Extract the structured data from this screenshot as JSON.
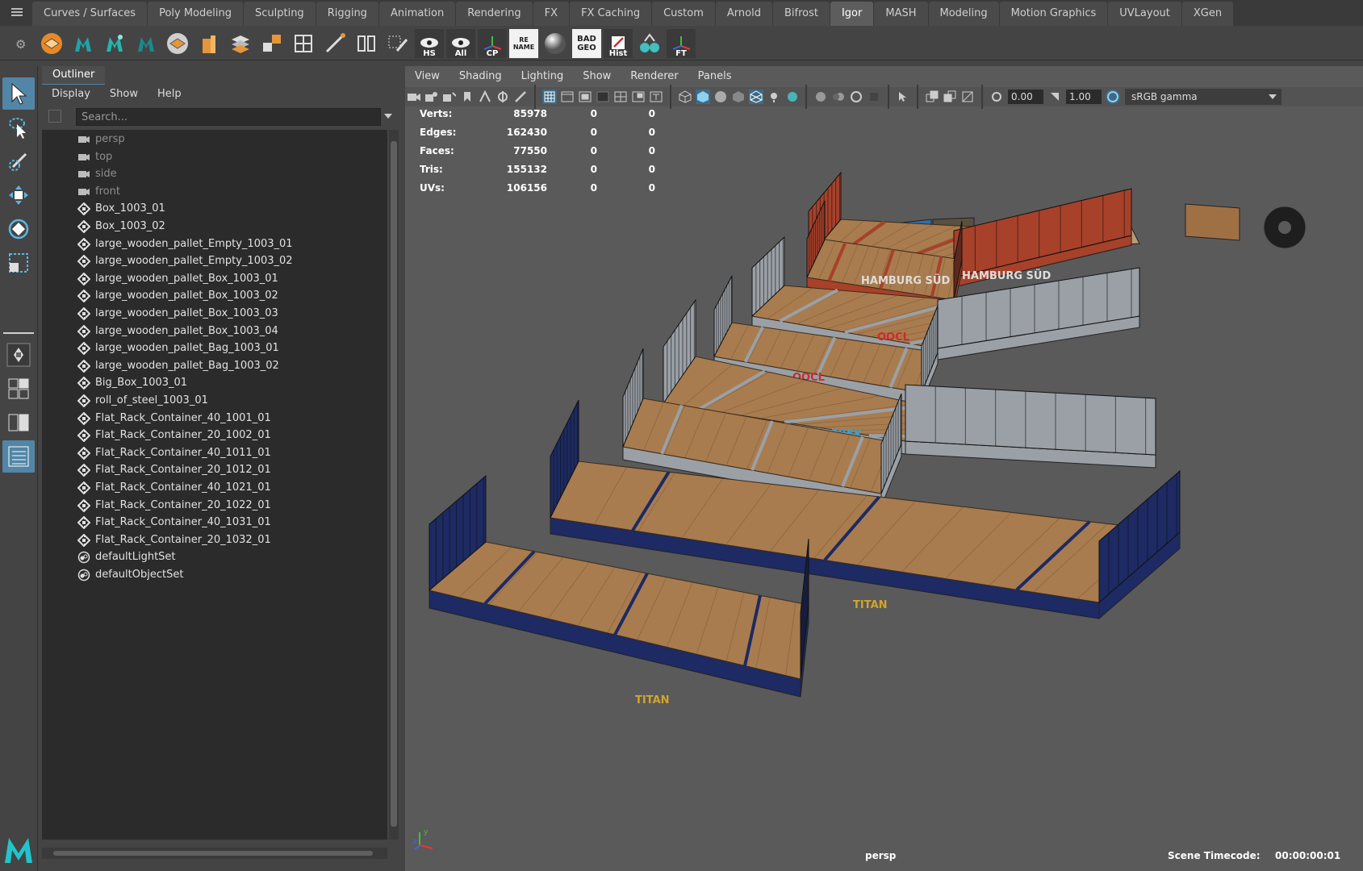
{
  "shelf": {
    "tabs": [
      {
        "label": "Curves / Surfaces"
      },
      {
        "label": "Poly Modeling"
      },
      {
        "label": "Sculpting"
      },
      {
        "label": "Rigging"
      },
      {
        "label": "Animation"
      },
      {
        "label": "Rendering"
      },
      {
        "label": "FX"
      },
      {
        "label": "FX Caching"
      },
      {
        "label": "Custom"
      },
      {
        "label": "Arnold"
      },
      {
        "label": "Bifrost"
      },
      {
        "label": "Igor",
        "active": true
      },
      {
        "label": "MASH"
      },
      {
        "label": "Modeling"
      },
      {
        "label": "Motion Graphics"
      },
      {
        "label": "UVLayout"
      },
      {
        "label": "XGen"
      }
    ],
    "buttons": {
      "hs": "HS",
      "all": "All",
      "cp": "CP",
      "rename": "RE NAME",
      "badgeo": "BAD GEO",
      "hist": "Hist",
      "ft": "FT"
    }
  },
  "outliner": {
    "title": "Outliner",
    "menu": [
      "Display",
      "Show",
      "Help"
    ],
    "search_placeholder": "Search...",
    "items": [
      {
        "label": "persp",
        "icon": "camera-icon",
        "camera": true
      },
      {
        "label": "top",
        "icon": "camera-icon",
        "camera": true
      },
      {
        "label": "side",
        "icon": "camera-icon",
        "camera": true
      },
      {
        "label": "front",
        "icon": "camera-icon",
        "camera": true
      },
      {
        "label": "Box_1003_01",
        "icon": "transform-icon"
      },
      {
        "label": "Box_1003_02",
        "icon": "transform-icon"
      },
      {
        "label": "large_wooden_pallet_Empty_1003_01",
        "icon": "transform-icon"
      },
      {
        "label": "large_wooden_pallet_Empty_1003_02",
        "icon": "transform-icon"
      },
      {
        "label": "large_wooden_pallet_Box_1003_01",
        "icon": "transform-icon"
      },
      {
        "label": "large_wooden_pallet_Box_1003_02",
        "icon": "transform-icon"
      },
      {
        "label": "large_wooden_pallet_Box_1003_03",
        "icon": "transform-icon"
      },
      {
        "label": "large_wooden_pallet_Box_1003_04",
        "icon": "transform-icon"
      },
      {
        "label": "large_wooden_pallet_Bag_1003_01",
        "icon": "transform-icon"
      },
      {
        "label": "large_wooden_pallet_Bag_1003_02",
        "icon": "transform-icon"
      },
      {
        "label": "Big_Box_1003_01",
        "icon": "transform-icon"
      },
      {
        "label": "roll_of_steel_1003_01",
        "icon": "transform-icon"
      },
      {
        "label": "Flat_Rack_Container_40_1001_01",
        "icon": "transform-icon"
      },
      {
        "label": "Flat_Rack_Container_20_1002_01",
        "icon": "transform-icon"
      },
      {
        "label": "Flat_Rack_Container_40_1011_01",
        "icon": "transform-icon"
      },
      {
        "label": "Flat_Rack_Container_20_1012_01",
        "icon": "transform-icon"
      },
      {
        "label": "Flat_Rack_Container_40_1021_01",
        "icon": "transform-icon"
      },
      {
        "label": "Flat_Rack_Container_20_1022_01",
        "icon": "transform-icon"
      },
      {
        "label": "Flat_Rack_Container_40_1031_01",
        "icon": "transform-icon"
      },
      {
        "label": "Flat_Rack_Container_20_1032_01",
        "icon": "transform-icon"
      },
      {
        "label": "defaultLightSet",
        "icon": "set-icon"
      },
      {
        "label": "defaultObjectSet",
        "icon": "set-icon"
      }
    ]
  },
  "viewport": {
    "menu": [
      "View",
      "Shading",
      "Lighting",
      "Show",
      "Renderer",
      "Panels"
    ],
    "exposure": "0.00",
    "gamma": "1.00",
    "color_space": "sRGB gamma",
    "hud": [
      {
        "label": "Verts:",
        "v1": "85978",
        "v2": "0",
        "v3": "0"
      },
      {
        "label": "Edges:",
        "v1": "162430",
        "v2": "0",
        "v3": "0"
      },
      {
        "label": "Faces:",
        "v1": "77550",
        "v2": "0",
        "v3": "0"
      },
      {
        "label": "Tris:",
        "v1": "155132",
        "v2": "0",
        "v3": "0"
      },
      {
        "label": "UVs:",
        "v1": "106156",
        "v2": "0",
        "v3": "0"
      }
    ],
    "camera": "persp",
    "timecode_label": "Scene Timecode:",
    "timecode": "00:00:00:01",
    "brands": {
      "hamburg": "HAMBURG SÜD",
      "oocl": "OOCL",
      "maersk": "MAERSK",
      "titan": "TITAN"
    },
    "axes": {
      "y": "y",
      "z": "z"
    }
  },
  "colors": {
    "accent": "#5285a6",
    "active_tab": "#5d5d5d",
    "viewport_bg": "#5a5a5a",
    "titan_blue": "#1d2a63",
    "hamburg_red": "#a8412a",
    "oocl_grey": "#9aa0a6",
    "wood": "#a87c4f"
  }
}
